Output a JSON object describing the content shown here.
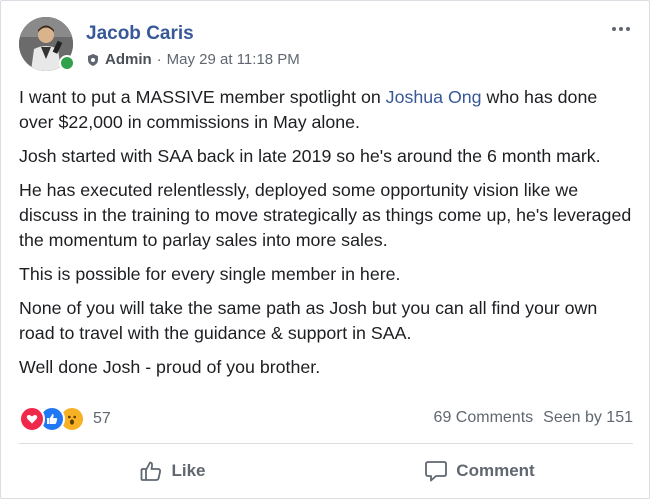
{
  "post": {
    "author": "Jacob Caris",
    "role": "Admin",
    "separator": "·",
    "timestamp": "May 29 at 11:18 PM",
    "paragraphs": [
      {
        "before": "I want to put a MASSIVE member spotlight on ",
        "mention": "Joshua Ong",
        "after": " who has done over $22,000 in commissions in May alone."
      },
      {
        "text": "Josh started with SAA back in late 2019 so he's around the 6 month mark."
      },
      {
        "text": "He has executed relentlessly, deployed some opportunity vision like we discuss in the training to move strategically as things come up, he's leveraged the momentum to parlay sales into more sales."
      },
      {
        "text": "This is possible for every single member in here."
      },
      {
        "text": "None of you will take the same path as Josh but you can all find your own road to travel with the guidance & support in SAA."
      },
      {
        "text": "Well done Josh - proud of you brother."
      }
    ]
  },
  "reactions": {
    "icons": [
      "love-icon",
      "like-icon",
      "wow-icon"
    ],
    "count": "57",
    "colors": {
      "love": "#f0284a",
      "like": "#2078f4",
      "wow": "#f7b125"
    }
  },
  "stats": {
    "comments": "69 Comments",
    "seen": "Seen by 151"
  },
  "actions": {
    "like_label": "Like",
    "comment_label": "Comment"
  },
  "theme": {
    "link_color": "#385898",
    "secondary_text": "#606770",
    "online_color": "#31a24c"
  }
}
